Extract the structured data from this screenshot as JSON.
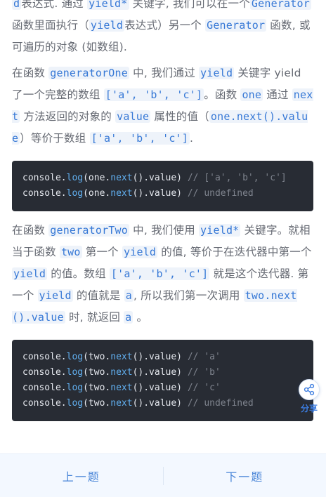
{
  "p1": {
    "t1": "d",
    "t2": "表达式. 通过 ",
    "c1": "yield*",
    "t3": " 关键字, 我们可以在一个",
    "c2": "Generator",
    "t4": " 函数里面执行（",
    "c3": "yield",
    "t5": "表达式）另一个 ",
    "c4": "Generator",
    "t6": " 函数, 或可遍历的对象 (如数组)."
  },
  "p2": {
    "t1": "在函数 ",
    "c1": "generatorOne",
    "t2": " 中, 我们通过 ",
    "c2": "yield",
    "t3": " 关键字 yield 了一个完整的数组 ",
    "c3": "['a', 'b', 'c']",
    "t4": "。函数 ",
    "c4": "one",
    "t5": " 通过 ",
    "c5": "next",
    "t6": " 方法返回的对象的 ",
    "c6": "value",
    "t7": " 属性的值（",
    "c7": "one.next().value",
    "t8": "）等价于数组 ",
    "c8": "['a', 'b', 'c']",
    "t9": "."
  },
  "code1": {
    "lines": [
      {
        "obj": "console.",
        "fn": "log",
        "a": "(one.",
        "fn2": "next",
        "b": "().value) ",
        "comment": "// ['a', 'b', 'c']"
      },
      {
        "obj": "console.",
        "fn": "log",
        "a": "(one.",
        "fn2": "next",
        "b": "().value) ",
        "comment": "// undefined"
      }
    ]
  },
  "p3": {
    "t1": "在函数 ",
    "c1": "generatorTwo",
    "t2": " 中, 我们使用 ",
    "c2": "yield*",
    "t3": " 关键字。就相当于函数 ",
    "c3": "two",
    "t4": " 第一个 ",
    "c4": "yield",
    "t5": " 的值, 等价于在迭代器中第一个 ",
    "c5": "yield",
    "t6": " 的值。数组 ",
    "c6": "['a', 'b', 'c']",
    "t7": " 就是这个迭代器. 第一个 ",
    "c7": "yield",
    "t8": " 的值就是 ",
    "c8": "a",
    "t9": ", 所以我们第一次调用 ",
    "c9": "two.next().value",
    "t10": " 时, 就返回 ",
    "c10": "a",
    "t11": " 。"
  },
  "code2": {
    "lines": [
      {
        "obj": "console.",
        "fn": "log",
        "a": "(two.",
        "fn2": "next",
        "b": "().value) ",
        "comment": "// 'a'"
      },
      {
        "obj": "console.",
        "fn": "log",
        "a": "(two.",
        "fn2": "next",
        "b": "().value) ",
        "comment": "// 'b'"
      },
      {
        "obj": "console.",
        "fn": "log",
        "a": "(two.",
        "fn2": "next",
        "b": "().value) ",
        "comment": "// 'c'"
      },
      {
        "obj": "console.",
        "fn": "log",
        "a": "(two.",
        "fn2": "next",
        "b": "().value) ",
        "comment": "// undefined"
      }
    ]
  },
  "share": {
    "label": "分享",
    "icon": "share-icon"
  },
  "nav": {
    "prev": "上一题",
    "next": "下一题"
  },
  "colors": {
    "accent": "#3678d6",
    "code_bg": "#282c34",
    "bar_bg": "#f3f8ff"
  }
}
